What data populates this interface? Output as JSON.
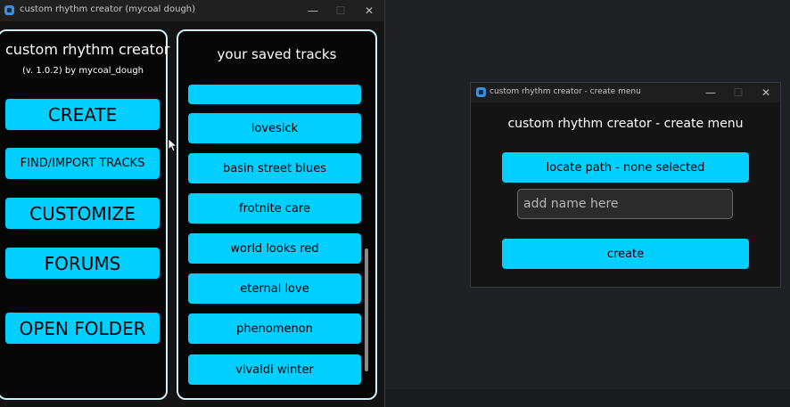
{
  "main_window": {
    "title": "custom rhythm creator (mycoal dough)",
    "controls": {
      "minimize": "—",
      "maximize": "☐",
      "close": "✕"
    }
  },
  "sidebar": {
    "title": "custom rhythm creator",
    "version": "(v. 1.0.2) by mycoal_dough",
    "buttons": [
      {
        "label": "CREATE"
      },
      {
        "label": "FIND/IMPORT TRACKS"
      },
      {
        "label": "CUSTOMIZE"
      },
      {
        "label": "FORUMS"
      },
      {
        "label": "OPEN FOLDER"
      }
    ]
  },
  "tracks": {
    "title": "your saved tracks",
    "items": [
      {
        "label": ""
      },
      {
        "label": "lovesick"
      },
      {
        "label": "basin street blues"
      },
      {
        "label": "frotnite care"
      },
      {
        "label": "world looks red"
      },
      {
        "label": "eternal love"
      },
      {
        "label": "phenomenon"
      },
      {
        "label": "vivaldi winter"
      }
    ]
  },
  "create_window": {
    "title": "custom rhythm creator - create menu",
    "heading": "custom rhythm creator - create menu",
    "locate_path_label": "locate path - none selected",
    "name_placeholder": "add name here",
    "name_value": "",
    "create_label": "create",
    "controls": {
      "minimize": "—",
      "maximize": "☐",
      "close": "✕"
    }
  },
  "colors": {
    "accent": "#00cfff",
    "panel_border": "#cfeff5",
    "window_bg": "#141414",
    "text": "#ffffff"
  },
  "icons": [
    "app-icon",
    "minimize-icon",
    "maximize-icon",
    "close-icon",
    "mouse-cursor-icon"
  ]
}
